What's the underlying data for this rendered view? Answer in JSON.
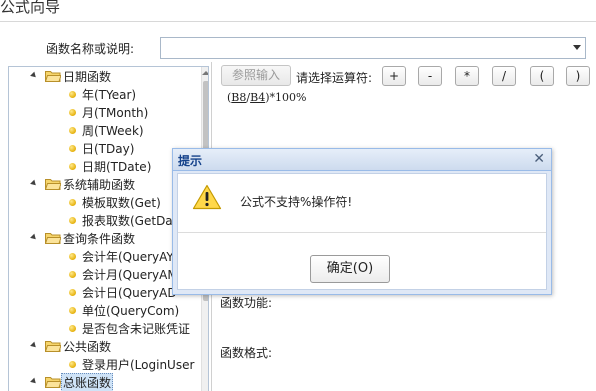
{
  "window": {
    "title": "公式向导"
  },
  "search": {
    "label": "函数名称或说明:",
    "value": ""
  },
  "tree": {
    "groups": [
      {
        "label": "日期函数",
        "items": [
          "年(TYear)",
          "月(TMonth)",
          "周(TWeek)",
          "日(TDay)",
          "日期(TDate)"
        ]
      },
      {
        "label": "系统辅助函数",
        "items": [
          "模板取数(Get)",
          "报表取数(GetDat"
        ]
      },
      {
        "label": "查询条件函数",
        "items": [
          "会计年(QueryAY",
          "会计月(QueryAM",
          "会计日(QueryAD",
          "单位(QueryCom)",
          "是否包含未记账凭证"
        ]
      },
      {
        "label": "公共函数",
        "items": [
          "登录用户(LoginUser"
        ]
      },
      {
        "label": "总账函数",
        "items": []
      }
    ]
  },
  "toolbar": {
    "ref_input_label": "参照输入",
    "operator_label": "请选择运算符:",
    "operators": [
      "+",
      "-",
      "*",
      "/",
      "(",
      ")"
    ]
  },
  "formula": {
    "prefix": "(",
    "ref1": "B8",
    "slash": "/",
    "ref2": "B4",
    "suffix": ")*100%"
  },
  "info": {
    "function_desc_label": "函数功能:",
    "function_format_label": "函数格式:"
  },
  "dialog": {
    "title": "提示",
    "message": "公式不支持%操作符!",
    "ok_label": "确定(O)",
    "close_glyph": "✕"
  },
  "colors": {
    "dialog_header": "#cddbee",
    "dialog_title": "#15428b",
    "dialog_border": "#99bbe8",
    "folder": "#e8c34a",
    "leaf_dot": "#e6b10d",
    "selected_bg": "#cfe3f7"
  }
}
